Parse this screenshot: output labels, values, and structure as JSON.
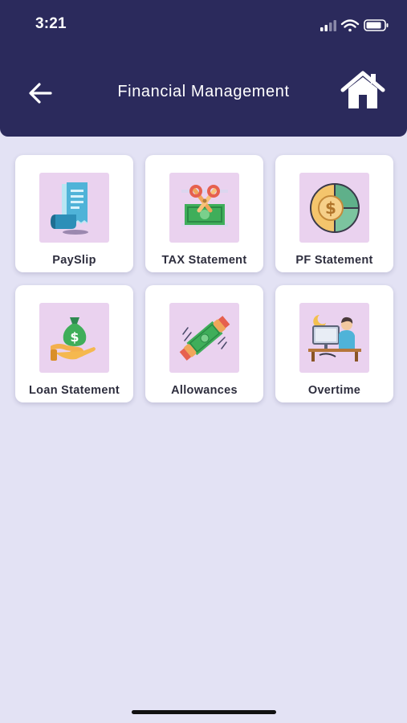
{
  "status_bar": {
    "time": "3:21",
    "icons": [
      "signal-icon",
      "wifi-icon",
      "battery-icon"
    ]
  },
  "header": {
    "title": "Financial Management",
    "back_icon": "arrow-left-icon",
    "home_icon": "home-icon"
  },
  "colors": {
    "header_bg": "#2b2a5c",
    "page_bg": "#e3e2f4",
    "card_bg": "#ffffff",
    "icon_box_bg": "#ead2ef"
  },
  "menu": {
    "items": [
      {
        "label": "PaySlip",
        "icon": "receipt-icon"
      },
      {
        "label": "TAX Statement",
        "icon": "tax-cash-icon"
      },
      {
        "label": "PF Statement",
        "icon": "pie-coin-icon"
      },
      {
        "label": "Loan Statement",
        "icon": "money-bag-hand-icon"
      },
      {
        "label": "Allowances",
        "icon": "money-handover-icon"
      },
      {
        "label": "Overtime",
        "icon": "night-work-icon"
      }
    ]
  }
}
